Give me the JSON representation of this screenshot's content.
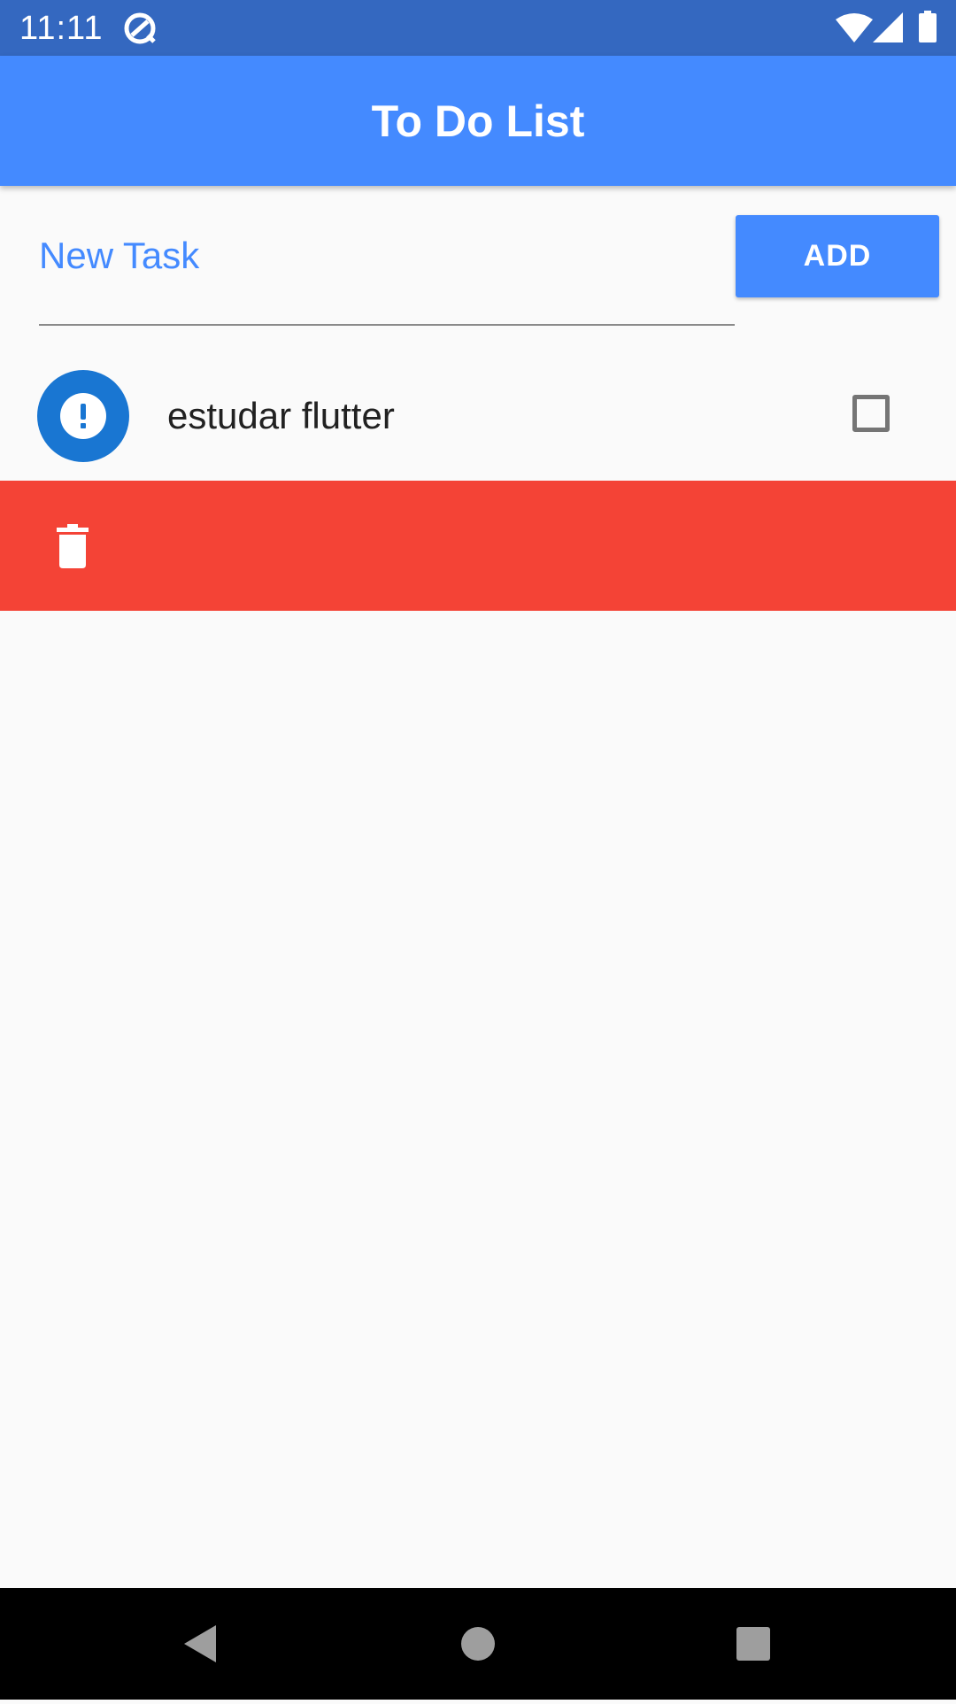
{
  "status_bar": {
    "time": "11:11",
    "icons": [
      "sync-icon",
      "wifi-icon",
      "signal-icon",
      "battery-icon"
    ],
    "background": "#3468c0"
  },
  "app_bar": {
    "title": "To Do List",
    "background": "#448aff"
  },
  "new_task": {
    "placeholder": "New Task",
    "value": "",
    "add_label": "ADD"
  },
  "tasks": [
    {
      "text": "estudar flutter",
      "icon": "exclamation-icon",
      "done": false
    }
  ],
  "dismiss": {
    "icon": "trash-icon",
    "background": "#f44336"
  },
  "nav_bar": {
    "buttons": [
      "back-icon",
      "home-icon",
      "recents-icon"
    ]
  }
}
